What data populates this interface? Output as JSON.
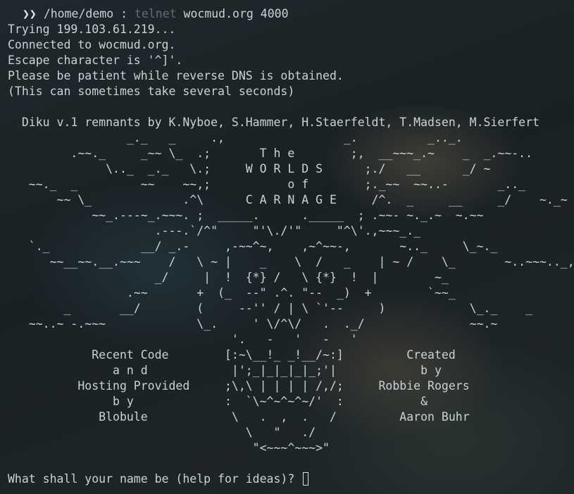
{
  "prompt": {
    "icon": "chevron-prompt-icon",
    "path": "/home/demo",
    "separator": ":",
    "command": "telnet",
    "args": "wocmud.org 4000"
  },
  "output_lines": [
    "Trying 199.103.61.219...",
    "Connected to wocmud.org.",
    "Escape character is '^]'.",
    "Please be patient while reverse DNS is obtained.",
    "(This can sometimes take several seconds)"
  ],
  "ascii_art": "  Diku v.1 remnants by K.Nyboe, S.Hammer, H.Staerfeldt, T.Madsen, M.Sierfert\n                 _._   _     .,                 _.          _.._.\n         .~~._     _~~ \\_  .;       T h e        ;,  __~~~_.~    _  _.~~-..\n              \\.._  _._   \\.;     W O R L D S      ;./   __      _/ ~\n   ~~._  _         ~~    ~~,;           o f        ;._~~  ~~..-       _.._\n       ~~ \\_             .^\\      C A R N A G E     /^.  _     __     _/    ~._~\n            ~~_.---~_.~~~. ;  _____.      ._____  ; .~~- ~._.~  ~.~~\n                     .---.`/^\"     \"'\\./'\"     \"^\\'.,~~~_._\n   `._             __/ _.-     ,-~~^~,    ,~^~~-,       ~.._     \\_~._\n      ~~__~~.__.~~~    /   \\ ~ |    _    \\  /   _    | ~ /    \\_       ~..~~~.._,~\n                     _/     |  !  {*} /   \\ {*}  !  |        ~_\n                 .~~       +  (_  --\" .^. \"--  _)  +        `~~_\n        _       __/        (     --'' / | \\ `'--     )            \\_._    _\n   ~~..~ -.~~~             \\_.     ' \\/^\\/   .  ._/               ~~.~\n                                '.   -   '   -   '\n            Recent Code        [:~\\__!_ _!__/~:]         Created\n               a n d            |';_|_|_|_|_;'|            b y\n          Hosting Provided     ;\\,\\ | | | | /,/;     Robbie Rogers\n               b y             :  `\\~^~^~^~/'  :           &\n             Blobule            \\   .  ,  .   /         Aaron Buhr\n                                  \\   \"   ./\n                                   \"<~~~^~~~>\"",
  "name_prompt": "What shall your name be (help for ideas)? "
}
